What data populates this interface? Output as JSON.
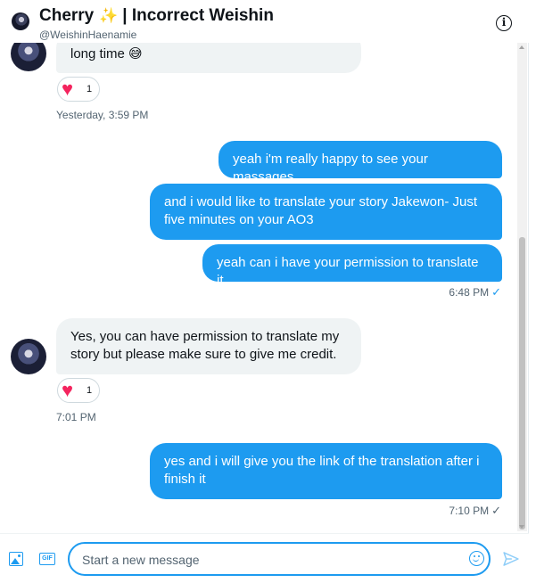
{
  "header": {
    "name": "Cherry",
    "name_suffix": "| Incorrect Weishin",
    "handle": "@WeishinHaenamie",
    "info_symbol": "i"
  },
  "messages": [
    {
      "direction": "incoming",
      "text": "long time 😅",
      "reaction": {
        "emoji": "♥",
        "count": "1"
      },
      "timestamp": "Yesterday, 3:59 PM"
    },
    {
      "direction": "outgoing",
      "text": "yeah i'm really happy to see your massages"
    },
    {
      "direction": "outgoing",
      "text": "and i would like to translate your story Jakewon- Just five minutes on your AO3"
    },
    {
      "direction": "outgoing",
      "text": "yeah can i have your permission to translate it",
      "timestamp": "6:48 PM",
      "status": "✓"
    },
    {
      "direction": "incoming",
      "text": "Yes, you can have permission to translate my story but please make sure to give me credit.",
      "reaction": {
        "emoji": "♥",
        "count": "1"
      },
      "timestamp": "7:01 PM"
    },
    {
      "direction": "outgoing",
      "text": "yes and i will give you the link of the translation after i finish it",
      "timestamp": "7:10 PM",
      "status": "✓"
    }
  ],
  "composer": {
    "placeholder": "Start a new message",
    "gif_label": "GIF"
  },
  "colors": {
    "accent": "#1d9bf0",
    "incoming_bubble": "#eff3f4",
    "heart": "#f4245e"
  },
  "icons": {
    "header_star": "dizzy-star-icon",
    "info": "info-icon",
    "media": "image-icon",
    "gif": "gif-icon",
    "emoji": "emoji-icon",
    "send": "send-icon",
    "reaction": "heart-icon"
  }
}
